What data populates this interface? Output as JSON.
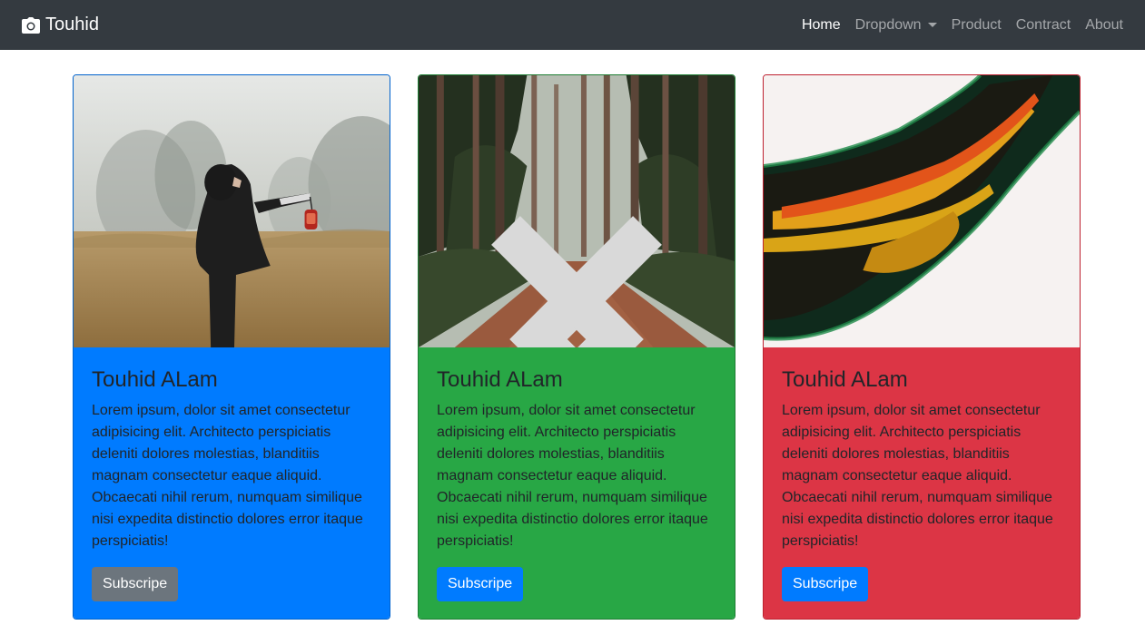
{
  "navbar": {
    "brand": "Touhid",
    "links": [
      {
        "label": "Home",
        "active": true
      },
      {
        "label": "Dropdown",
        "dropdown": true
      },
      {
        "label": "Product"
      },
      {
        "label": "Contract"
      },
      {
        "label": "About"
      }
    ]
  },
  "cards": [
    {
      "title": "Touhid ALam",
      "text": "Lorem ipsum, dolor sit amet consectetur adipisicing elit. Architecto perspiciatis deleniti dolores molestias, blanditiis magnam consectetur eaque aliquid. Obcaecati nihil rerum, numquam similique nisi expedita distinctio dolores error itaque perspiciatis!",
      "button": "Subscripe",
      "bg_color": "#007bff",
      "button_color": "#6c757d",
      "image": "woman-with-lantern-in-foggy-field"
    },
    {
      "title": "Touhid ALam",
      "text": "Lorem ipsum, dolor sit amet consectetur adipisicing elit. Architecto perspiciatis deleniti dolores molestias, blanditiis magnam consectetur eaque aliquid. Obcaecati nihil rerum, numquam similique nisi expedita distinctio dolores error itaque perspiciatis!",
      "button": "Subscripe",
      "bg_color": "#28a745",
      "button_color": "#007bff",
      "image": "forest-path-carousel"
    },
    {
      "title": "Touhid ALam",
      "text": "Lorem ipsum, dolor sit amet consectetur adipisicing elit. Architecto perspiciatis deleniti dolores molestias, blanditiis magnam consectetur eaque aliquid. Obcaecati nihil rerum, numquam similique nisi expedita distinctio dolores error itaque perspiciatis!",
      "button": "Subscripe",
      "bg_color": "#dc3545",
      "button_color": "#007bff",
      "image": "abstract-fluid-paint"
    }
  ]
}
